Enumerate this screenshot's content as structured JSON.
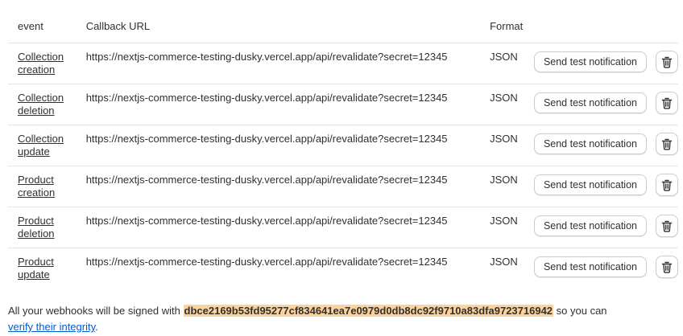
{
  "table": {
    "headers": {
      "event": "event",
      "url": "Callback URL",
      "format": "Format"
    },
    "rows": [
      {
        "event_line1": "Collection",
        "event_line2": "creation",
        "url": "https://nextjs-commerce-testing-dusky.vercel.app/api/revalidate?secret=12345",
        "format": "JSON",
        "test_label": "Send test notification"
      },
      {
        "event_line1": "Collection",
        "event_line2": "deletion",
        "url": "https://nextjs-commerce-testing-dusky.vercel.app/api/revalidate?secret=12345",
        "format": "JSON",
        "test_label": "Send test notification"
      },
      {
        "event_line1": "Collection",
        "event_line2": "update",
        "url": "https://nextjs-commerce-testing-dusky.vercel.app/api/revalidate?secret=12345",
        "format": "JSON",
        "test_label": "Send test notification"
      },
      {
        "event_line1": "Product",
        "event_line2": "creation",
        "url": "https://nextjs-commerce-testing-dusky.vercel.app/api/revalidate?secret=12345",
        "format": "JSON",
        "test_label": "Send test notification"
      },
      {
        "event_line1": "Product",
        "event_line2": "deletion",
        "url": "https://nextjs-commerce-testing-dusky.vercel.app/api/revalidate?secret=12345",
        "format": "JSON",
        "test_label": "Send test notification"
      },
      {
        "event_line1": "Product",
        "event_line2": "update",
        "url": "https://nextjs-commerce-testing-dusky.vercel.app/api/revalidate?secret=12345",
        "format": "JSON",
        "test_label": "Send test notification"
      }
    ],
    "delete_icon": "trash-icon"
  },
  "footer": {
    "prefix": "All your webhooks will be signed with",
    "secret": "dbce2169b53fd95277cf834641ea7e0979d0db8dc92f9710a83dfa9723716942",
    "suffix": "so you can",
    "link": "verify their integrity",
    "period": "."
  },
  "colors": {
    "secret_highlight": "#fcd39c",
    "link": "#005bd3",
    "divider": "#e3e3e3"
  }
}
